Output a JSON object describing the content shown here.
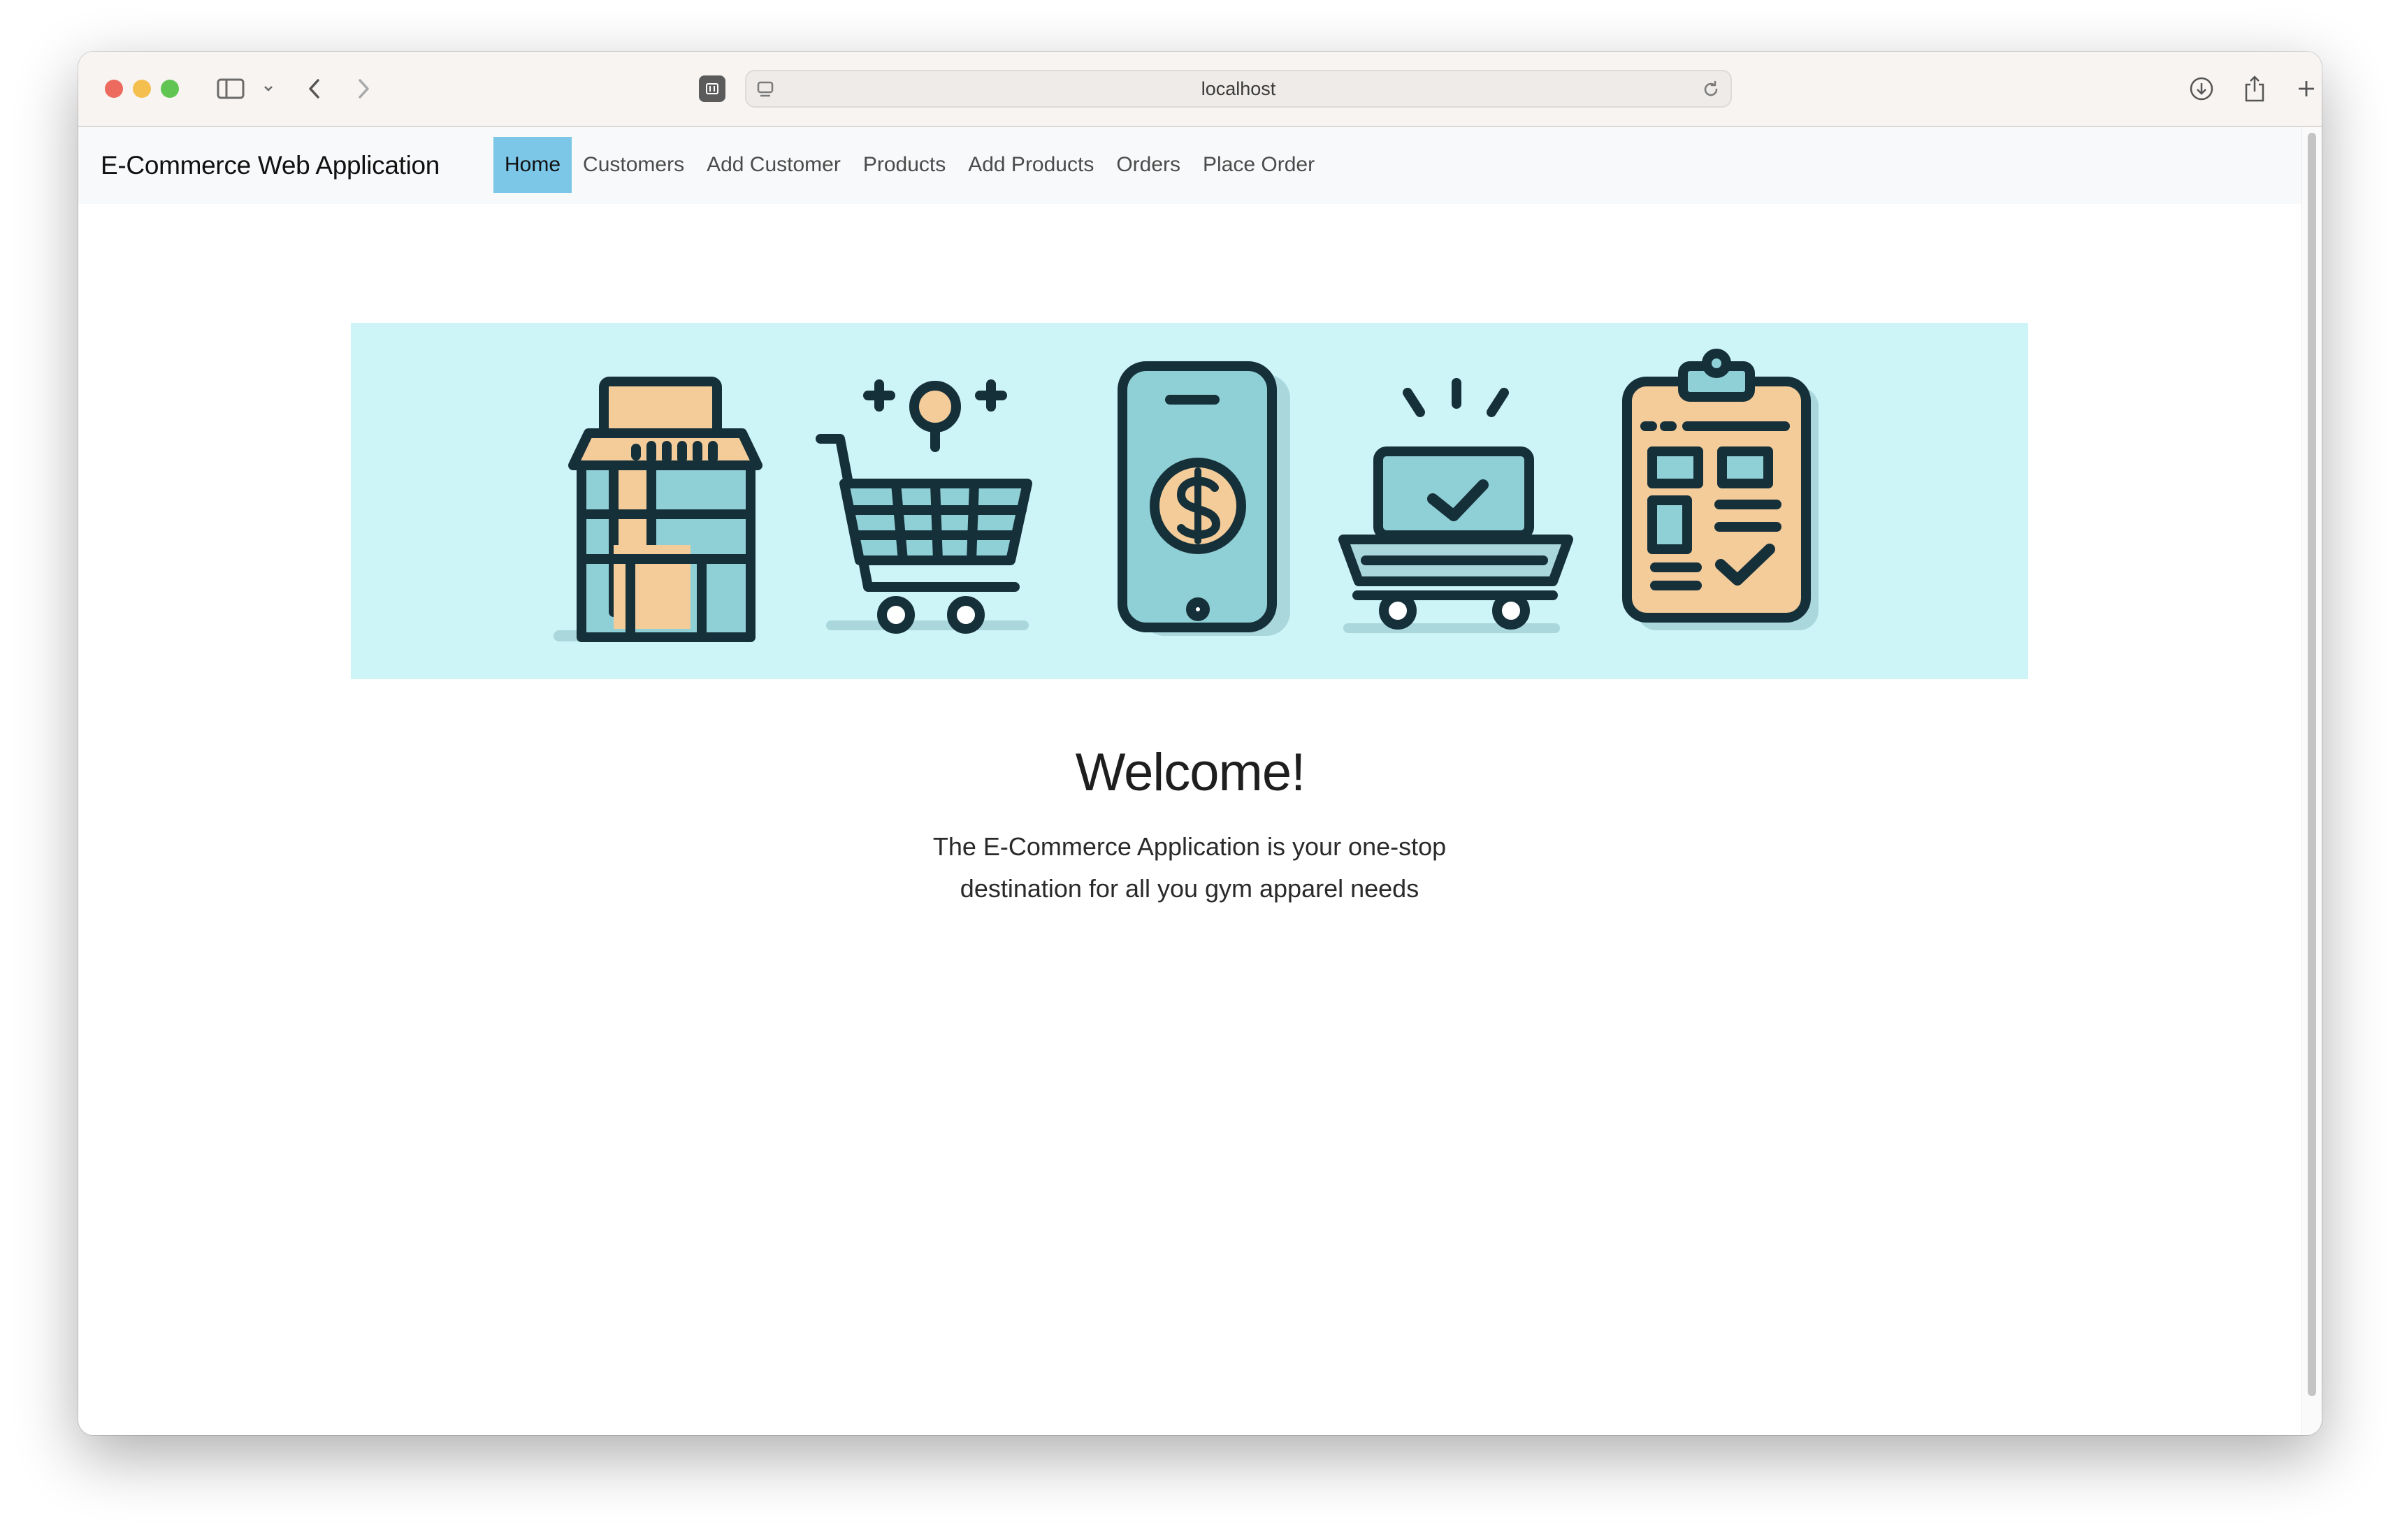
{
  "browser": {
    "url": "localhost"
  },
  "navbar": {
    "brand": "E-Commerce Web Application",
    "links": [
      {
        "label": "Home",
        "active": true
      },
      {
        "label": "Customers",
        "active": false
      },
      {
        "label": "Add Customer",
        "active": false
      },
      {
        "label": "Products",
        "active": false
      },
      {
        "label": "Add Products",
        "active": false
      },
      {
        "label": "Orders",
        "active": false
      },
      {
        "label": "Place Order",
        "active": false
      }
    ]
  },
  "hero": {
    "icons": [
      "storefront-icon",
      "shopping-cart-icon",
      "mobile-payment-icon",
      "delivery-cart-icon",
      "order-checklist-icon"
    ]
  },
  "main": {
    "title": "Welcome!",
    "description": "The E-Commerce Application is your one-stop destination for all you gym apparel needs"
  },
  "colors": {
    "hero_bg": "#cdf4f7",
    "nav_active": "#7cc7e8",
    "icon_teal": "#8fcfd6",
    "icon_beige": "#f3cc9a",
    "icon_outline": "#16303a"
  }
}
